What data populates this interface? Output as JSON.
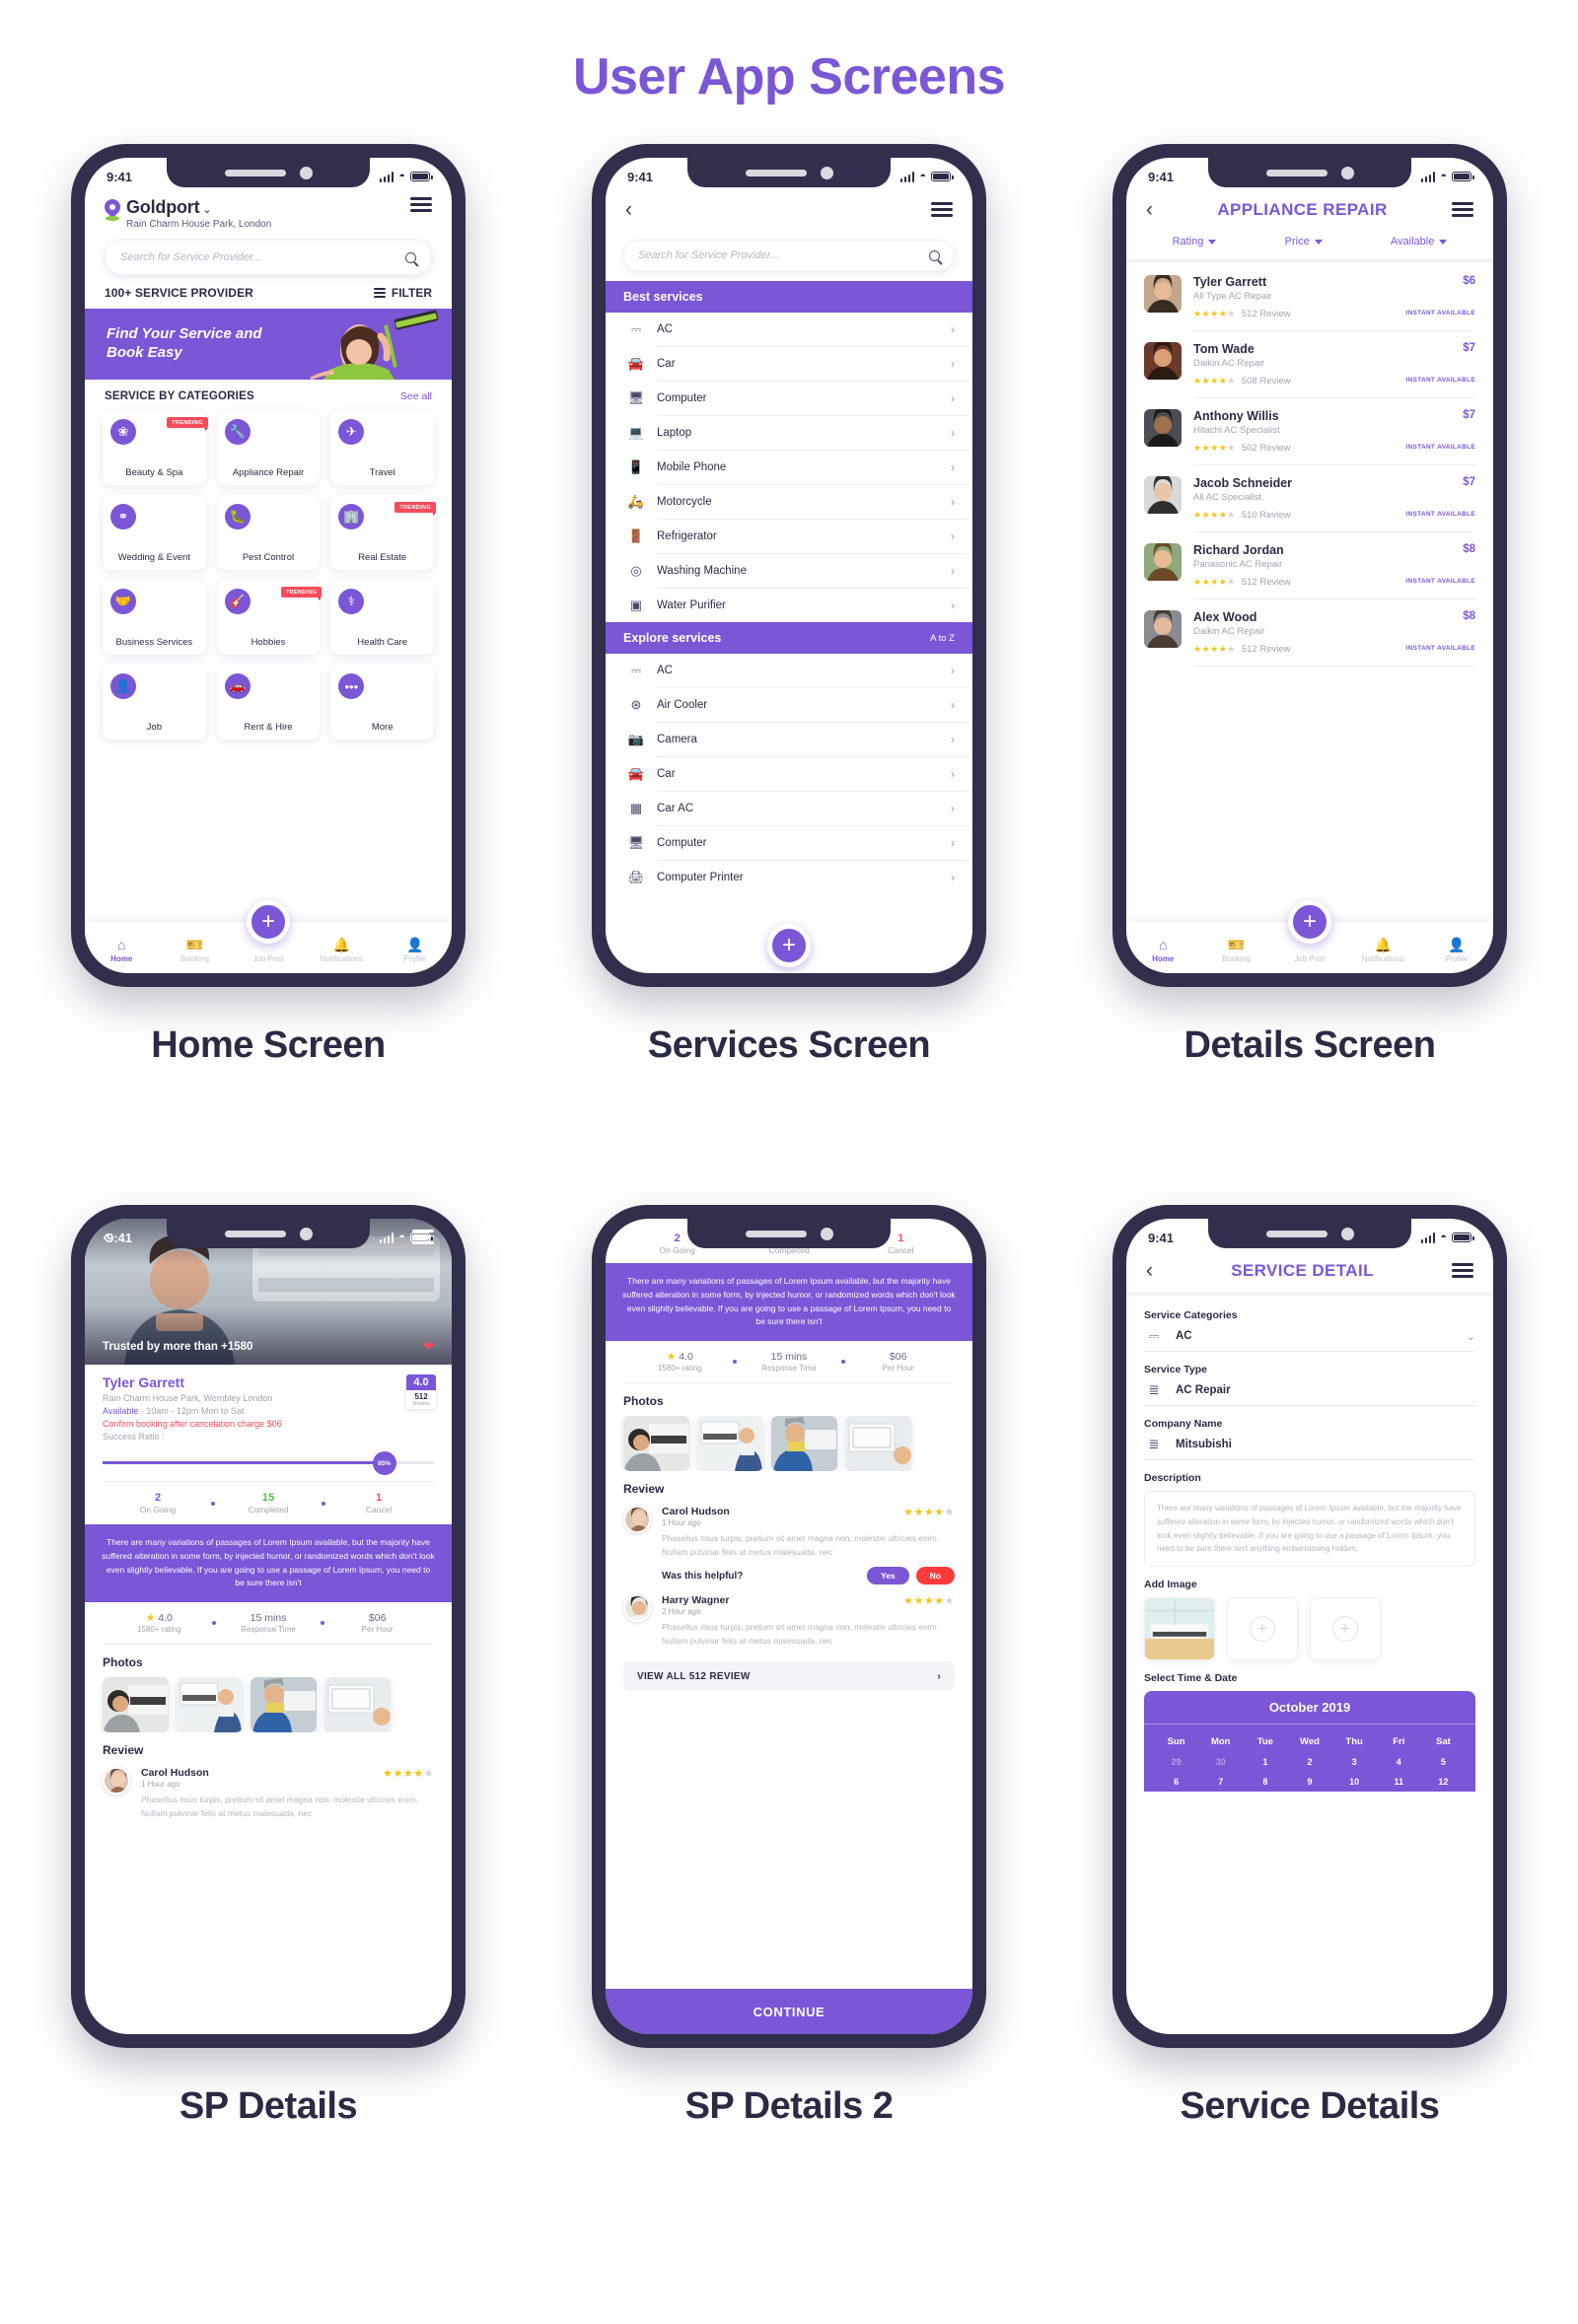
{
  "page": {
    "title": "User App Screens"
  },
  "captions": {
    "home": "Home Screen",
    "services": "Services Screen",
    "details": "Details Screen",
    "sp_details": "SP Details",
    "sp_details_2": "SP Details 2",
    "service_details": "Service Details"
  },
  "status_bar": {
    "time": "9:41"
  },
  "home": {
    "brand_name": "Goldport",
    "brand_caret": "⌄",
    "address": "Rain Charm House Park, London",
    "search_placeholder": "Search for Service Provider...",
    "provider_count": "100+ SERVICE PROVIDER",
    "filter_label": "FILTER",
    "banner_line1": "Find Your Service and",
    "banner_line2": "Book Easy",
    "categories_title": "SERVICE BY CATEGORIES",
    "see_all": "See all",
    "trending_label": "TRENDING",
    "categories": [
      {
        "label": "Beauty & Spa",
        "icon": "lotus-icon",
        "glyph": "❀",
        "trending": true
      },
      {
        "label": "Appliance Repair",
        "icon": "wrench-icon",
        "glyph": "🔧",
        "trending": false
      },
      {
        "label": "Travel",
        "icon": "plane-icon",
        "glyph": "✈",
        "trending": false
      },
      {
        "label": "Wedding & Event",
        "icon": "rings-icon",
        "glyph": "⚭",
        "trending": false
      },
      {
        "label": "Pest Control",
        "icon": "bug-icon",
        "glyph": "🐛",
        "trending": false
      },
      {
        "label": "Real Estate",
        "icon": "building-icon",
        "glyph": "🏢",
        "trending": true
      },
      {
        "label": "Business Services",
        "icon": "handshake-icon",
        "glyph": "🤝",
        "trending": false
      },
      {
        "label": "Hobbies",
        "icon": "guitar-icon",
        "glyph": "🎸",
        "trending": true
      },
      {
        "label": "Health Care",
        "icon": "nurse-icon",
        "glyph": "⚕",
        "trending": false
      },
      {
        "label": "Job",
        "icon": "person-icon",
        "glyph": "👤",
        "trending": false
      },
      {
        "label": "Rent & Hire",
        "icon": "rentcar-icon",
        "glyph": "🚗",
        "trending": false
      },
      {
        "label": "More",
        "icon": "ellipsis-icon",
        "glyph": "•••",
        "trending": false
      }
    ]
  },
  "bottom_nav": {
    "items": [
      {
        "label": "Home",
        "icon": "home-icon",
        "glyph": "⌂",
        "active": true
      },
      {
        "label": "Booking",
        "icon": "ticket-icon",
        "glyph": "🎫",
        "active": false
      },
      {
        "label": "Job Post",
        "icon": "plus-icon",
        "glyph": "",
        "active": false
      },
      {
        "label": "Notifications",
        "icon": "bell-icon",
        "glyph": "🔔",
        "active": false
      },
      {
        "label": "Profile",
        "icon": "user-icon",
        "glyph": "👤",
        "active": false
      }
    ],
    "fab_label": "+"
  },
  "services": {
    "search_placeholder": "Search for Service Provider...",
    "best_header": "Best services",
    "explore_header": "Explore services",
    "explore_sort": "A to Z",
    "arrow": "›",
    "best_items": [
      {
        "label": "AC",
        "icon": "ac-unit-icon",
        "glyph": "⎓"
      },
      {
        "label": "Car",
        "icon": "car-icon",
        "glyph": "🚘"
      },
      {
        "label": "Computer",
        "icon": "desktop-icon",
        "glyph": "🖥"
      },
      {
        "label": "Laptop",
        "icon": "laptop-icon",
        "glyph": "💻"
      },
      {
        "label": "Mobile Phone",
        "icon": "mobile-icon",
        "glyph": "📱"
      },
      {
        "label": "Motorcycle",
        "icon": "scooter-icon",
        "glyph": "🛵"
      },
      {
        "label": "Refrigerator",
        "icon": "fridge-icon",
        "glyph": "🚪"
      },
      {
        "label": "Washing Machine",
        "icon": "washing-machine-icon",
        "glyph": "◎"
      },
      {
        "label": "Water Purifier",
        "icon": "water-purifier-icon",
        "glyph": "▣"
      }
    ],
    "explore_items": [
      {
        "label": "AC",
        "icon": "ac-unit-icon",
        "glyph": "⎓"
      },
      {
        "label": "Air Cooler",
        "icon": "cooler-icon",
        "glyph": "⊛"
      },
      {
        "label": "Camera",
        "icon": "camera-icon",
        "glyph": "📷"
      },
      {
        "label": "Car",
        "icon": "car-icon",
        "glyph": "🚘"
      },
      {
        "label": "Car AC",
        "icon": "car-ac-icon",
        "glyph": "▦"
      },
      {
        "label": "Computer",
        "icon": "desktop-icon",
        "glyph": "🖥"
      },
      {
        "label": "Computer Printer",
        "icon": "printer-icon",
        "glyph": "🖨"
      }
    ]
  },
  "details": {
    "header_title": "APPLIANCE REPAIR",
    "sorts": [
      "Rating",
      "Price",
      "Available"
    ],
    "instant_label": "INSTANT AVAILABLE",
    "providers": [
      {
        "name": "Tyler Garrett",
        "service": "All Type AC Repair",
        "reviews": "512 Review",
        "price": "$6",
        "stars": 4
      },
      {
        "name": "Tom Wade",
        "service": "Daikin AC Repair",
        "reviews": "508 Review",
        "price": "$7",
        "stars": 4
      },
      {
        "name": "Anthony Willis",
        "service": "Hitachi AC Specialist",
        "reviews": "502 Review",
        "price": "$7",
        "stars": 4
      },
      {
        "name": "Jacob Schneider",
        "service": "All AC Specialist",
        "reviews": "510 Review",
        "price": "$7",
        "stars": 4
      },
      {
        "name": "Richard Jordan",
        "service": "Panasonic AC Repair",
        "reviews": "512 Review",
        "price": "$8",
        "stars": 4
      },
      {
        "name": "Alex Wood",
        "service": "Daikin AC Repair",
        "reviews": "512 Review",
        "price": "$8",
        "stars": 4
      }
    ]
  },
  "sp_details": {
    "trusted": "Trusted by more than +1580",
    "name": "Tyler Garrett",
    "address": "Rain Charm House Park, Wembley London",
    "available_label": "Available",
    "available_value": " - 10am - 12pm Mon to Sat",
    "cancel_note": "Confirm booking after cancelation charge $06",
    "success_label": "Success Ratio :",
    "success_pct": "85%",
    "rating_value": "4.0",
    "rating_count": "512",
    "rating_count_label": "Review",
    "stats": [
      {
        "value": "2",
        "label": "On Going"
      },
      {
        "value": "15",
        "label": "Completed"
      },
      {
        "value": "1",
        "label": "Cancel"
      }
    ],
    "paragraph": "There are many variations of passages of Lorem Ipsum available, but the majority have suffered alteration in some form, by injected humor, or randomized words which don't look even slightly believable. If you are going to use a passage of Lorem Ipsum, you need to be sure there isn't",
    "metrics": [
      {
        "value": "★ 4.0",
        "label": "1580+ rating"
      },
      {
        "value": "15 mins",
        "label": "Response Time"
      },
      {
        "value": "$06",
        "label": "Per Hour"
      }
    ],
    "photos_title": "Photos",
    "review_title": "Review",
    "reviews": [
      {
        "name": "Carol Hudson",
        "time": "1 Hour ago",
        "stars": 4,
        "text": "Phasellus risus turpis, pretium sit amet magna non, molestie ultricies enim. Nullam pulvinar felis at metus malesuada, nec"
      },
      {
        "name": "Harry Wagner",
        "time": "2 Hour ago",
        "stars": 4,
        "text": "Phasellus risus turpis, pretium sit amet magna non, molestie ultricies enim. Nullam pulvinar felis at metus malesuada, nec"
      }
    ],
    "helpful_question": "Was this helpful?",
    "helpful_yes": "Yes",
    "helpful_no": "No",
    "view_all": "VIEW ALL 512 REVIEW",
    "continue_label": "CONTINUE"
  },
  "service_detail": {
    "header_title": "SERVICE DETAIL",
    "fields": [
      {
        "label": "Service Categories",
        "value": "AC",
        "icon": "ac-unit-icon",
        "glyph": "⎓",
        "dropdown": true
      },
      {
        "label": "Service Type",
        "value": "AC Repair",
        "icon": "layers-icon",
        "glyph": "≣",
        "dropdown": false
      },
      {
        "label": "Company Name",
        "value": "Mitsubishi",
        "icon": "layers-icon",
        "glyph": "≣",
        "dropdown": false
      }
    ],
    "description_label": "Description",
    "description": "There are many variations of passages of Lorem Ipsum available, but the majority have suffered alteration in some form, by injected humor, or randomized words which don't look even slightly believable. If you are going to use a passage of Lorem Ipsum, you need to be sure there isn't anything embarrassing hidden.",
    "add_image_label": "Add Image",
    "add_plus": "+",
    "select_time_label": "Select Time & Date",
    "calendar": {
      "month": "October 2019",
      "dow": [
        "Sun",
        "Mon",
        "Tue",
        "Wed",
        "Thu",
        "Fri",
        "Sat"
      ],
      "weeks": [
        [
          {
            "d": "29",
            "muted": true
          },
          {
            "d": "30",
            "muted": true
          },
          {
            "d": "1",
            "muted": false
          },
          {
            "d": "2",
            "muted": false
          },
          {
            "d": "3",
            "muted": false
          },
          {
            "d": "4",
            "muted": false
          },
          {
            "d": "5",
            "muted": false
          }
        ],
        [
          {
            "d": "6",
            "muted": false
          },
          {
            "d": "7",
            "muted": false
          },
          {
            "d": "8",
            "muted": false
          },
          {
            "d": "9",
            "muted": false
          },
          {
            "d": "10",
            "muted": false
          },
          {
            "d": "11",
            "muted": false
          },
          {
            "d": "12",
            "muted": false
          }
        ]
      ]
    }
  },
  "colors": {
    "accent": "#7b56d6",
    "danger": "#fb4b5b",
    "dark": "#2b2b45",
    "muted": "#a3a3b5",
    "star": "#f5c518",
    "green": "#57b846"
  }
}
